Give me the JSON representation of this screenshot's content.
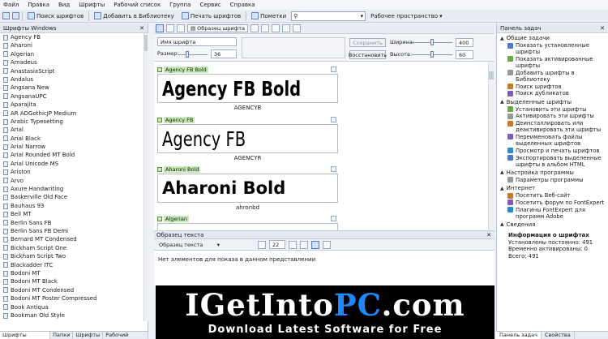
{
  "menu": [
    "Файл",
    "Правка",
    "Вид",
    "Шрифты",
    "Рабочий список",
    "Группа",
    "Сервис",
    "Справка"
  ],
  "toolbar": {
    "find": "Поиск шрифтов",
    "add": "Добавить в Библиотеку",
    "print": "Печать шрифтов",
    "marks": "Пометки",
    "search_placeholder": "",
    "workspace": "Рабочее пространство"
  },
  "left_panel": {
    "title": "Шрифты Windows",
    "fonts": [
      "Agency FB",
      "Aharoni",
      "Algerian",
      "Amadeus",
      "AnastasiaScript",
      "Andalus",
      "Angsana New",
      "AngsanaUPC",
      "Aparajita",
      "AR ADGothicJP Medium",
      "Arabic Typesetting",
      "Arial",
      "Arial Black",
      "Arial Narrow",
      "Arial Rounded MT Bold",
      "Arial Unicode MS",
      "Ariston",
      "Arvo",
      "Axure Handwriting",
      "Baskerville Old Face",
      "Bauhaus 93",
      "Bell MT",
      "Berlin Sans FB",
      "Berlin Sans FB Demi",
      "Bernard MT Condensed",
      "Bickham Script One",
      "Bickham Script Two",
      "Blackadder ITC",
      "Bodoni MT",
      "Bodoni MT Black",
      "Bodoni MT Condensed",
      "Bodoni MT Poster Compressed",
      "Book Antiqua",
      "Bookman Old Style"
    ],
    "tabs": [
      "Шрифты Windows",
      "Папки",
      "Шрифты",
      "Рабочий список"
    ]
  },
  "view_toolbar": {
    "sample_btn": "Образец шрифта"
  },
  "settings": {
    "font_name": "Имя шрифта",
    "size_label": "Размер:",
    "size_value": "36",
    "save": "Сохранить",
    "restore": "Восстановить",
    "width_label": "Ширина:",
    "width_value": "400",
    "height_label": "Высота:",
    "height_value": "60",
    "size_fraction": 0.3,
    "width_fraction": 0.5,
    "height_fraction": 0.5
  },
  "cards": [
    {
      "name": "Agency FB Bold",
      "sample": "Agency FB Bold",
      "file": "AGENCYB"
    },
    {
      "name": "Agency FB",
      "sample": "Agency FB",
      "file": "AGENCYR"
    },
    {
      "name": "Aharoni Bold",
      "sample": "Aharoni Bold",
      "file": "ahronbd"
    },
    {
      "name": "Algerian",
      "sample": "",
      "file": ""
    }
  ],
  "sample_panel": {
    "title": "Образец текста",
    "combo": "Образец текста",
    "size": "22",
    "empty": "Нет элементов для показа в данном представлении"
  },
  "task_panel": {
    "title": "Панель задач",
    "sections": [
      {
        "title": "Общие задачи",
        "items": [
          "Показать установленные шрифты",
          "Показать активированные шрифты",
          "Добавить шрифты в Библиотеку",
          "Поиск шрифтов",
          "Поиск дубликатов"
        ]
      },
      {
        "title": "Выделенные шрифты",
        "items": [
          "Установить эти шрифты",
          "Активировать эти шрифты",
          "Деинсталлировать или деактивировать эти шрифты",
          "Переименовать файлы выделенных шрифтов",
          "Просмотр и печать шрифтов",
          "Экспортировать выделенные шрифты в альбом HTML"
        ]
      },
      {
        "title": "Настройка программы",
        "items": [
          "Параметры программы"
        ]
      },
      {
        "title": "Интернет",
        "items": [
          "Посетить Веб-сайт",
          "Посетить форум по FontExpert",
          "Плагины FontExpert для программ Adobe"
        ]
      },
      {
        "title": "Сведения",
        "items": []
      }
    ],
    "info_title": "Информация о шрифтах",
    "info": [
      "Установлены постоянно: 491",
      "Временно активированы: 0",
      "Всего: 491"
    ],
    "tabs": [
      "Панель задач",
      "Свойства"
    ]
  },
  "watermark": {
    "main_1": "IGetInto",
    "main_2": "PC",
    "main_3": ".com",
    "sub": "Download Latest Software for Free"
  },
  "colors": {
    "accent": "#4f79c4",
    "tag_green": "#c6e8b6",
    "wm_blue": "#1e88ff"
  }
}
